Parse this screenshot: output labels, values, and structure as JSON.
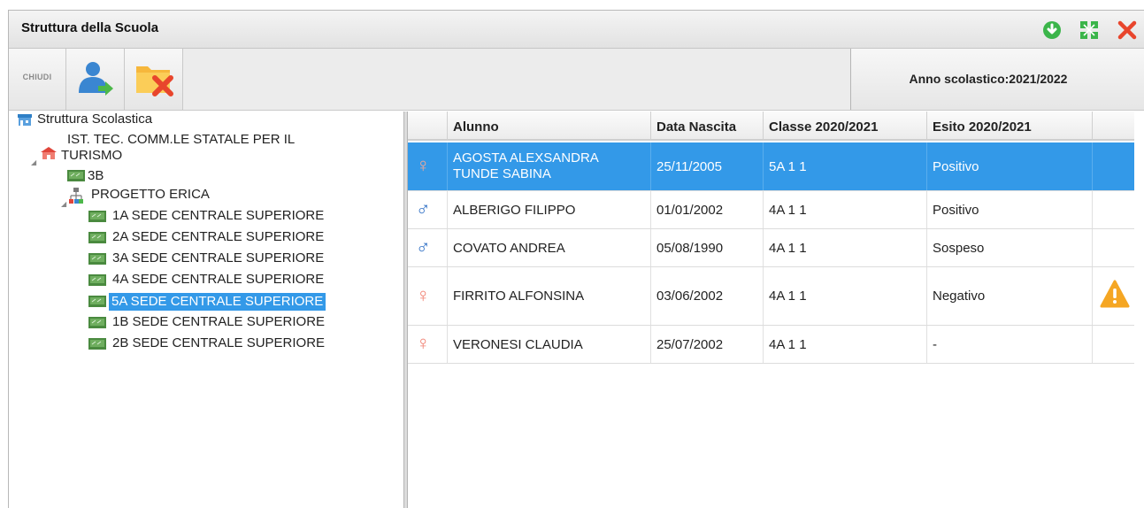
{
  "window": {
    "title": "Struttura della Scuola",
    "controls": [
      "download-icon",
      "maximize-icon",
      "close-icon"
    ]
  },
  "toolbar": {
    "close_label": "CHIUDI",
    "school_year": "Anno scolastico:2021/2022"
  },
  "tree": {
    "root": "Struttura Scolastica",
    "school_line1": "IST. TEC. COMM.LE STATALE PER IL",
    "school_line2": "TURISMO",
    "nodes": {
      "n3b": "3B",
      "progetto": "PROGETTO ERICA",
      "c1a": "1A SEDE CENTRALE SUPERIORE",
      "c2a": "2A SEDE CENTRALE SUPERIORE",
      "c3a": "3A SEDE CENTRALE SUPERIORE",
      "c4a": "4A SEDE CENTRALE SUPERIORE",
      "c5a": "5A SEDE CENTRALE SUPERIORE",
      "c1b": "1B SEDE CENTRALE SUPERIORE",
      "c2b": "2B SEDE CENTRALE SUPERIORE"
    },
    "selected": "5A SEDE CENTRALE SUPERIORE"
  },
  "grid": {
    "columns": {
      "alunno": "Alunno",
      "data_nascita": "Data Nascita",
      "classe": "Classe 2020/2021",
      "esito": "Esito 2020/2021"
    },
    "rows": [
      {
        "sex": "female",
        "alunno_line1": "AGOSTA ALEXSANDRA",
        "alunno_line2": "TUNDE SABINA",
        "data_nascita": "25/11/2005",
        "classe": "5A 1 1",
        "esito": "Positivo",
        "selected": true,
        "warning": false
      },
      {
        "sex": "male",
        "alunno_line1": "ALBERIGO FILIPPO",
        "alunno_line2": "",
        "data_nascita": "01/01/2002",
        "classe": "4A 1 1",
        "esito": "Positivo",
        "selected": false,
        "warning": false
      },
      {
        "sex": "male",
        "alunno_line1": "COVATO ANDREA",
        "alunno_line2": "",
        "data_nascita": "05/08/1990",
        "classe": "4A 1 1",
        "esito": "Sospeso",
        "selected": false,
        "warning": false
      },
      {
        "sex": "female",
        "alunno_line1": "FIRRITO ALFONSINA",
        "alunno_line2": "",
        "data_nascita": "03/06/2002",
        "classe": "4A 1 1",
        "esito": "Negativo",
        "selected": false,
        "warning": true
      },
      {
        "sex": "female",
        "alunno_line1": "VERONESI CLAUDIA",
        "alunno_line2": "",
        "data_nascita": "25/07/2002",
        "classe": "4A 1 1",
        "esito": "-",
        "selected": false,
        "warning": false
      }
    ]
  },
  "symbols": {
    "female": "♀",
    "male": "♂"
  },
  "colors": {
    "selection": "#3399e8",
    "female_symbol": "#f07f70",
    "male_symbol": "#2e6fc5",
    "warning": "#f5a623",
    "close_red": "#e8452c",
    "accent_green": "#3bb54a"
  }
}
